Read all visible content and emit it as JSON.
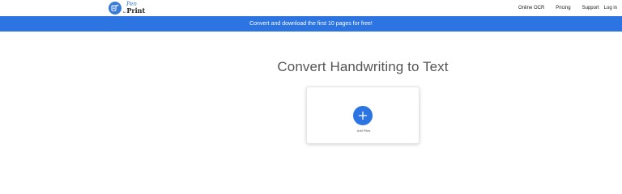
{
  "header": {
    "logo": {
      "pen_text": "Pen",
      "by_text": "to",
      "print_text": "Print"
    },
    "nav": {
      "online_ocr": "Online OCR",
      "pricing": "Pricing",
      "support": "Support",
      "login": "Log in"
    }
  },
  "banner": {
    "text": "Convert and download the first 10 pages for free!"
  },
  "main": {
    "title": "Convert Handwriting to Text",
    "upload": {
      "label": "Add Files"
    }
  },
  "colors": {
    "brand_blue": "#2b74e2",
    "logo_blue": "#3a7bd5",
    "title_gray": "#555555"
  }
}
